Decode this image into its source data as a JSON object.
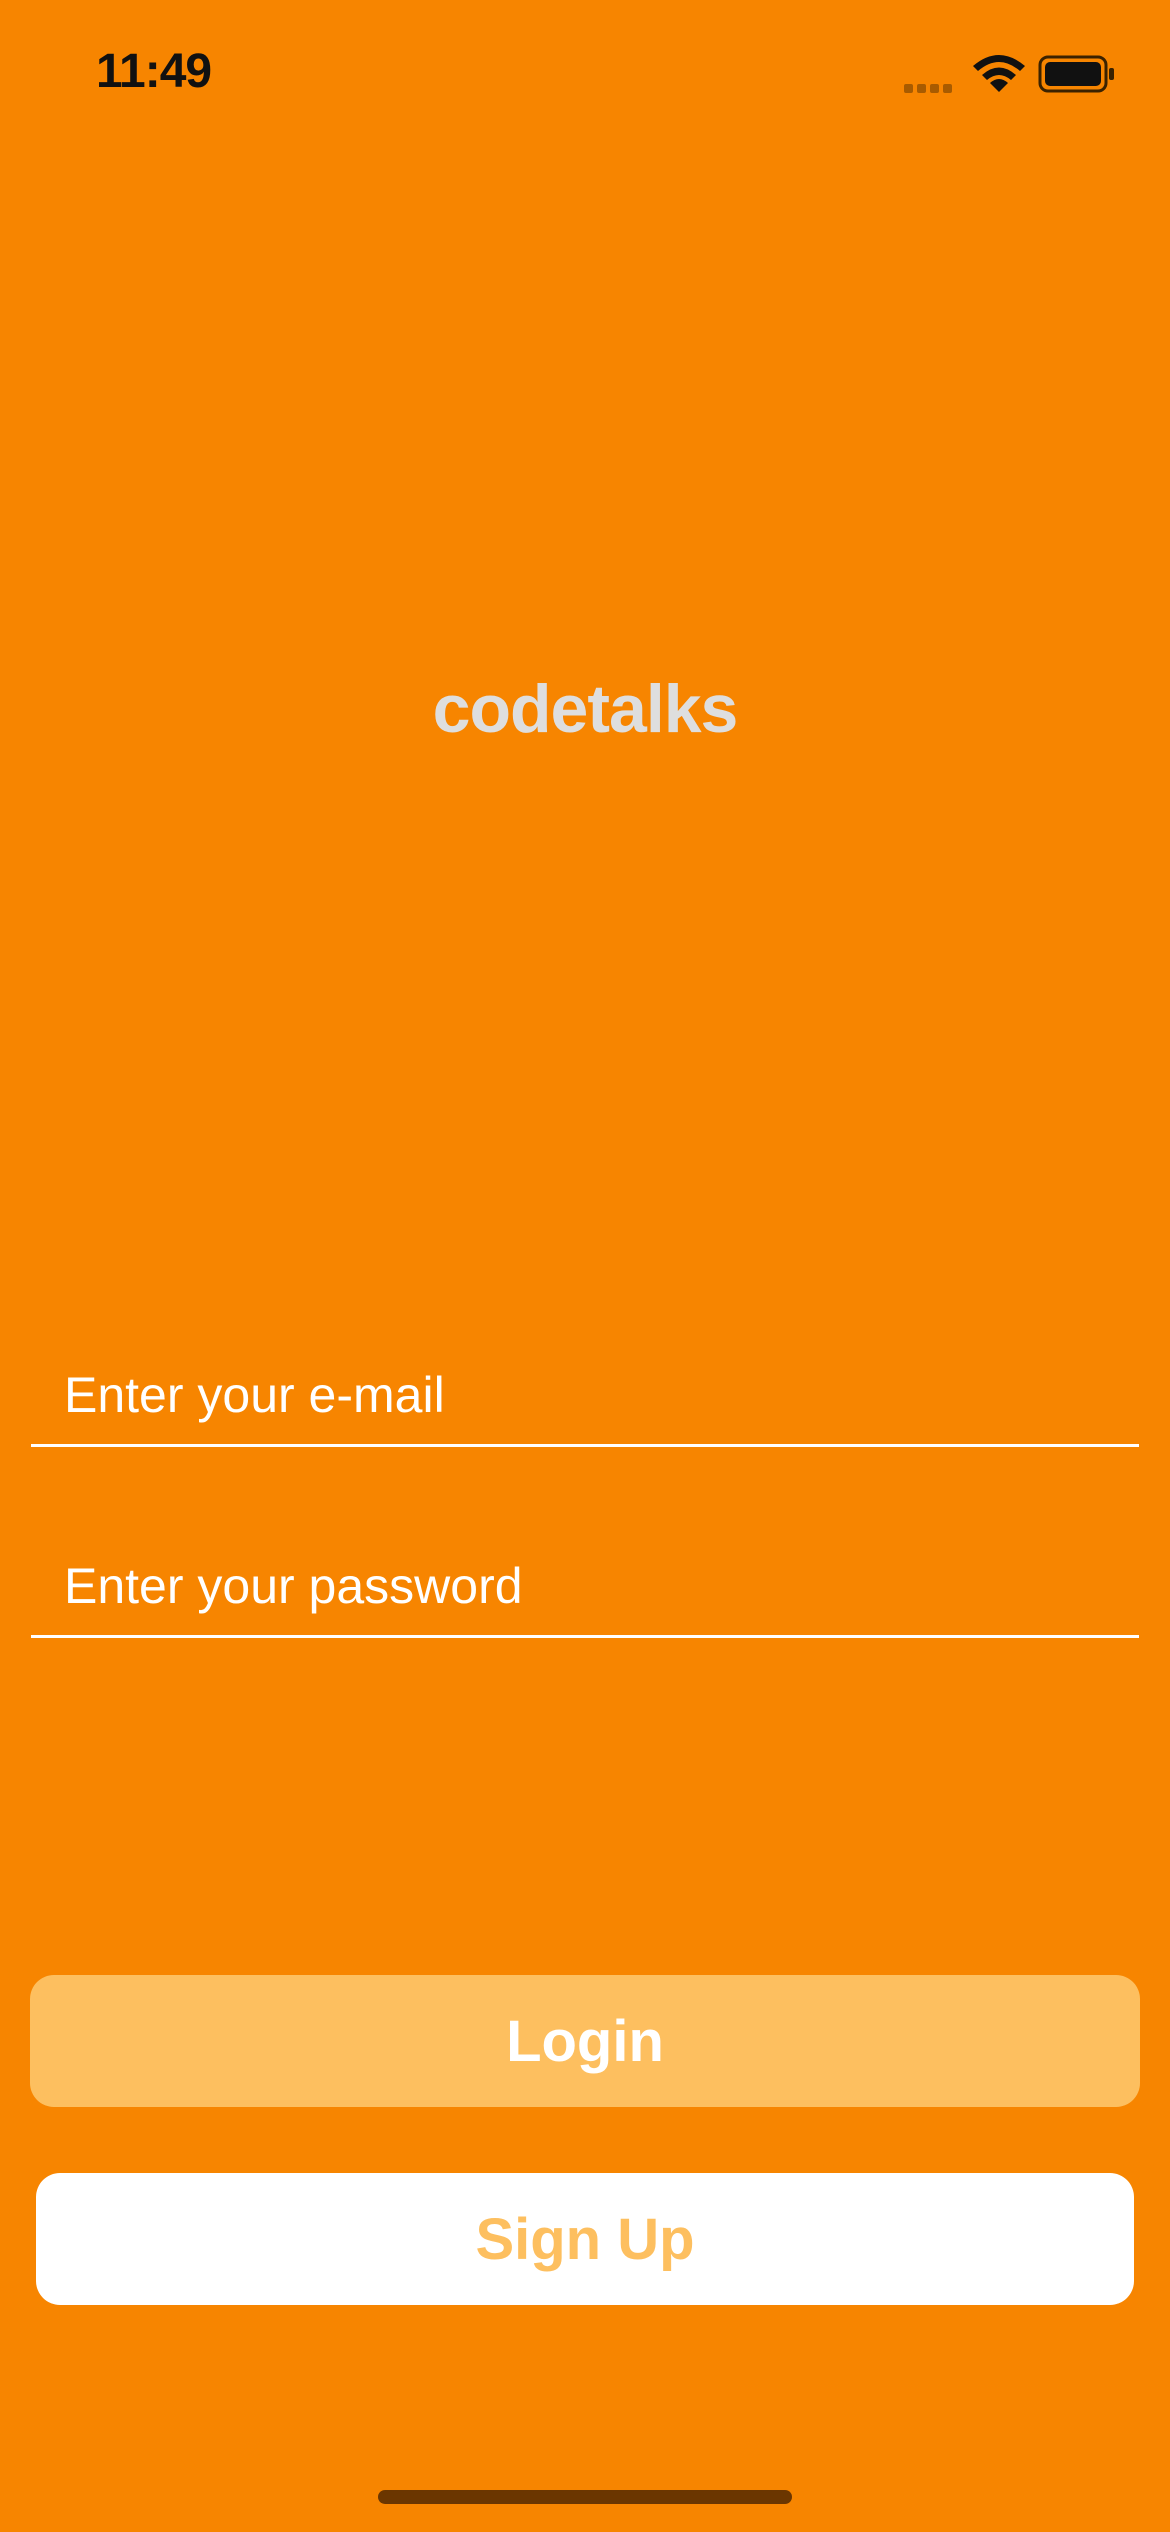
{
  "status_bar": {
    "time": "11:49",
    "icons": [
      "cellular-signal-icon",
      "wifi-icon",
      "battery-icon"
    ]
  },
  "app": {
    "title": "codetalks"
  },
  "form": {
    "email_placeholder": "Enter your e-mail",
    "email_value": "",
    "password_placeholder": "Enter your password",
    "password_value": ""
  },
  "actions": {
    "login_label": "Login",
    "signup_label": "Sign Up"
  },
  "colors": {
    "background": "#f78500",
    "title": "#dedede",
    "login_button": "#fdbf5f",
    "signup_button": "#ffffff",
    "signup_text": "#fdbf5f"
  }
}
